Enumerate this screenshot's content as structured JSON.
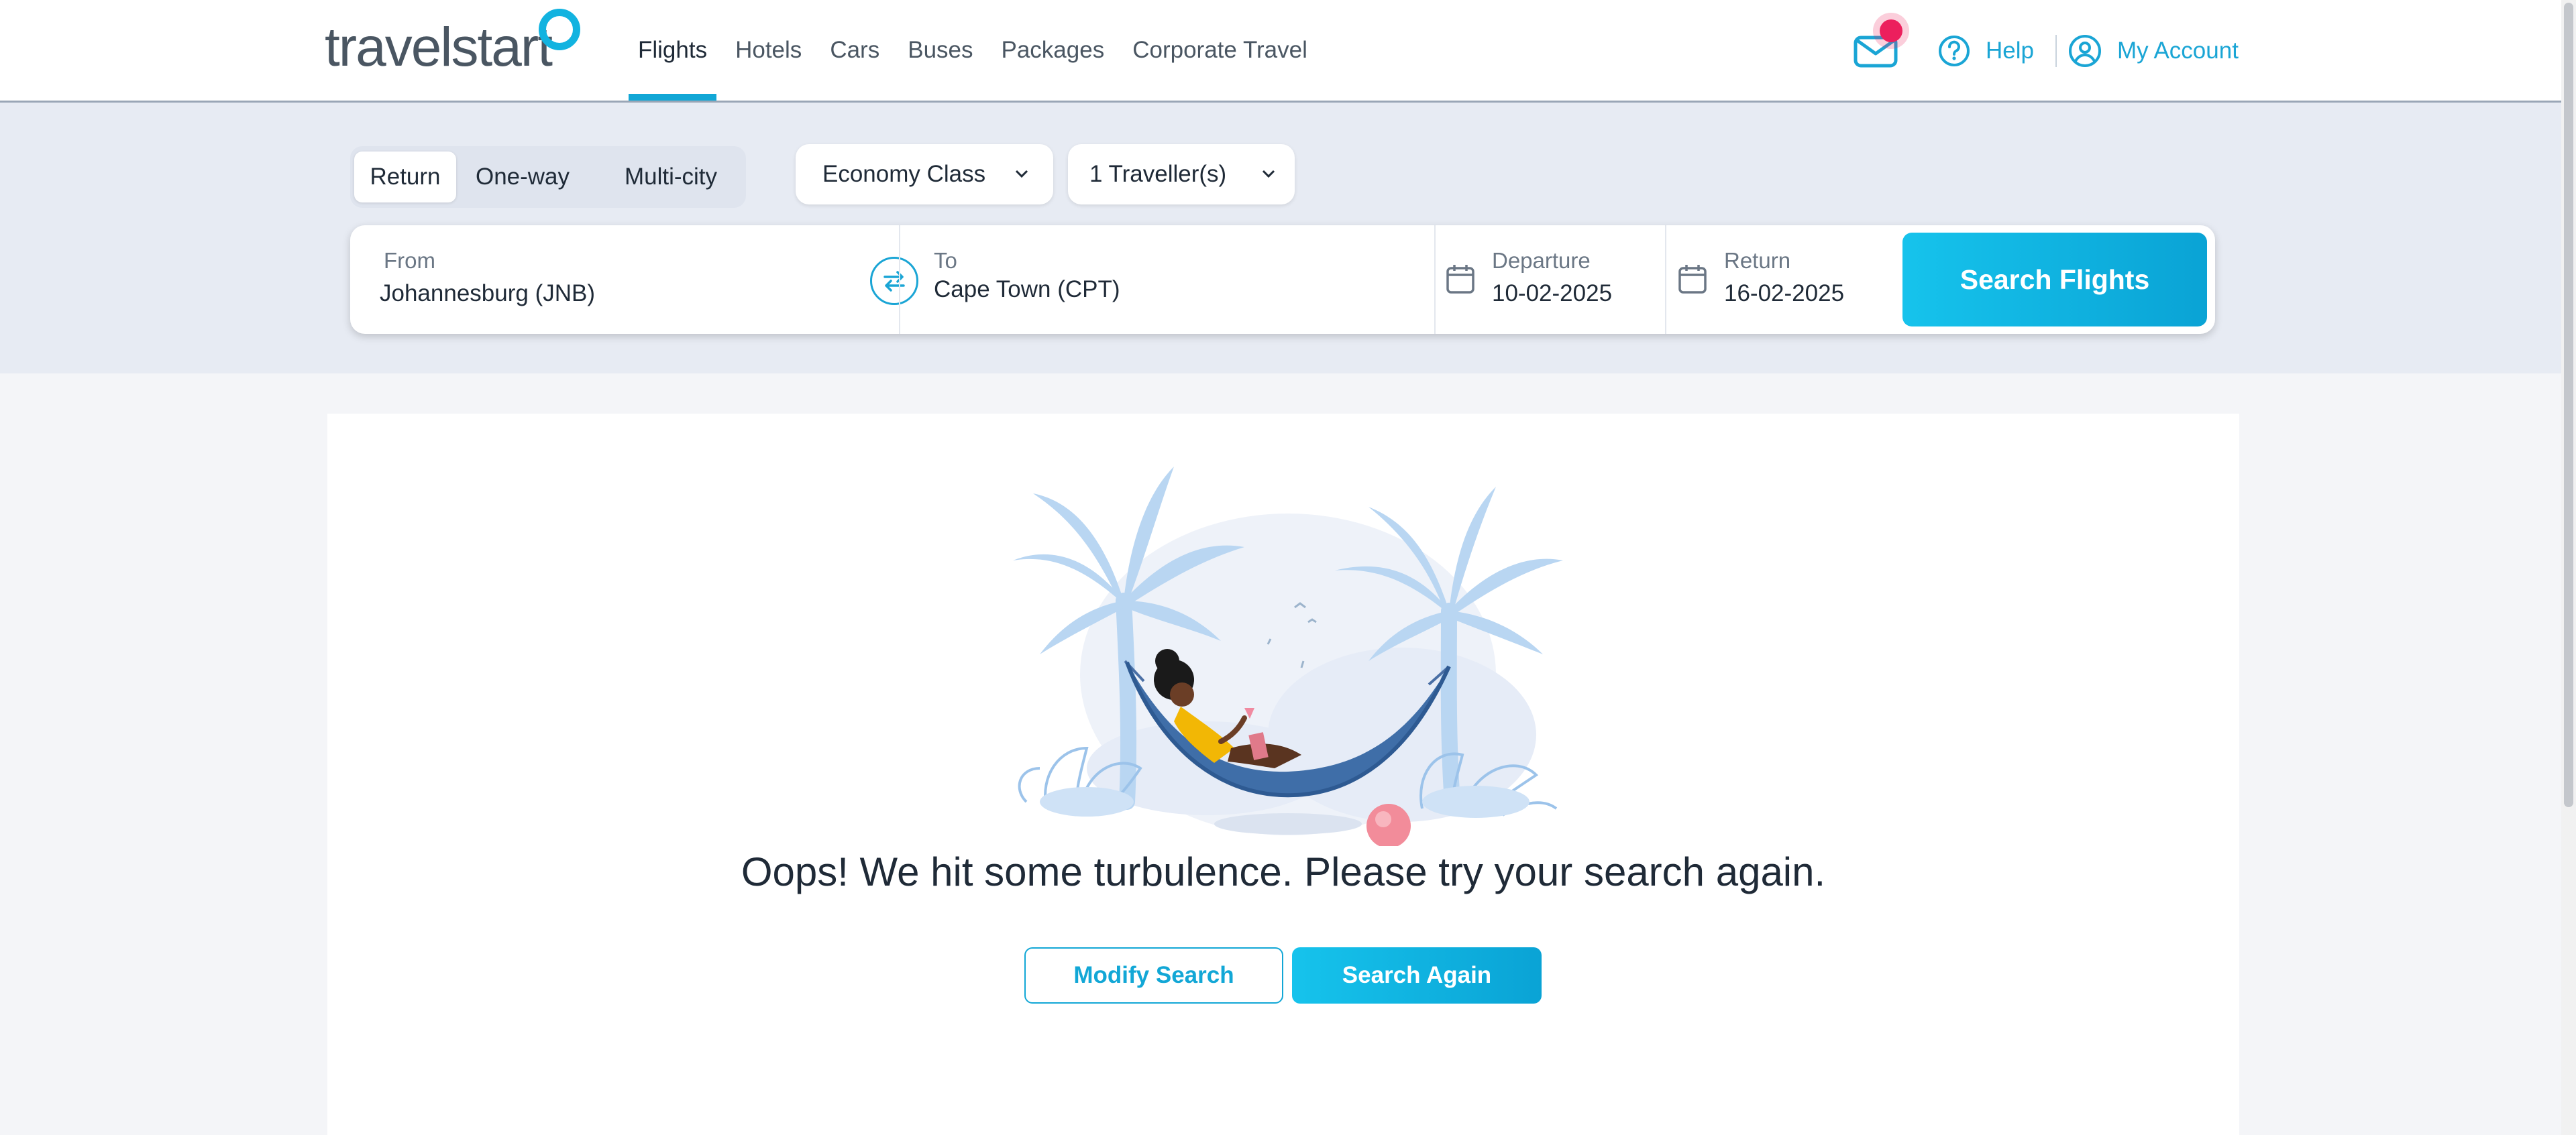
{
  "header": {
    "logo_text": "travelstart",
    "nav": [
      {
        "label": "Flights",
        "active": true
      },
      {
        "label": "Hotels"
      },
      {
        "label": "Cars"
      },
      {
        "label": "Buses"
      },
      {
        "label": "Packages"
      },
      {
        "label": "Corporate Travel"
      }
    ],
    "help_label": "Help",
    "account_label": "My Account",
    "notification_icon": "mail-icon",
    "notification_dot_color": "#ec1f5d"
  },
  "search": {
    "trip_types": [
      "Return",
      "One-way",
      "Multi-city"
    ],
    "selected_trip_type": "Return",
    "cabin_class": "Economy Class",
    "travellers": "1 Traveller(s)",
    "from_label": "From",
    "from_value": "Johannesburg (JNB)",
    "to_label": "To",
    "to_value": "Cape Town (CPT)",
    "departure_label": "Departure",
    "departure_value": "10-02-2025",
    "return_label": "Return",
    "return_value": "16-02-2025",
    "search_button": "Search Flights"
  },
  "content": {
    "error_message": "Oops! We hit some turbulence. Please try your search again.",
    "modify_button": "Modify Search",
    "search_again_button": "Search Again"
  },
  "colors": {
    "accent": "#12a7d6",
    "button_gradient_start": "#16c3ec",
    "button_gradient_end": "#0aa3d5",
    "search_band": "#e7ebf3"
  }
}
